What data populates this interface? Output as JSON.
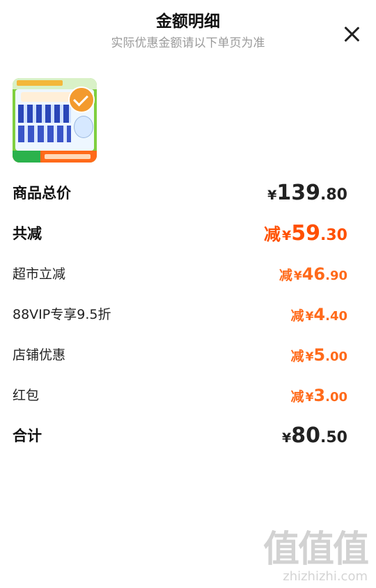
{
  "header": {
    "title": "金额明细",
    "subtitle": "实际优惠金额请以下单页为准"
  },
  "product": {
    "thumbnail_icon": "product-thumbnail"
  },
  "rows": [
    {
      "label": "商品总价",
      "minus": "",
      "currency": "¥",
      "int": "139",
      "dec": ".80",
      "style": "main",
      "color": "#222222"
    },
    {
      "label": "共减",
      "minus": "减",
      "currency": "¥",
      "int": "59",
      "dec": ".30",
      "style": "main",
      "color": "#ff5000"
    },
    {
      "label": "超市立减",
      "minus": "减",
      "currency": "¥",
      "int": "46",
      "dec": ".90",
      "style": "sub",
      "color": "#ff6a1a"
    },
    {
      "label": "88VIP专享9.5折",
      "minus": "减",
      "currency": "¥",
      "int": "4",
      "dec": ".40",
      "style": "sub",
      "color": "#ff6a1a"
    },
    {
      "label": "店铺优惠",
      "minus": "减",
      "currency": "¥",
      "int": "5",
      "dec": ".00",
      "style": "sub",
      "color": "#ff6a1a"
    },
    {
      "label": "红包",
      "minus": "减",
      "currency": "¥",
      "int": "3",
      "dec": ".00",
      "style": "sub",
      "color": "#ff6a1a"
    },
    {
      "label": "合计",
      "minus": "",
      "currency": "¥",
      "int": "80",
      "dec": ".50",
      "style": "main",
      "color": "#222222"
    }
  ],
  "watermark": {
    "logo": "值值值",
    "url": "zhizhizhi.com"
  }
}
